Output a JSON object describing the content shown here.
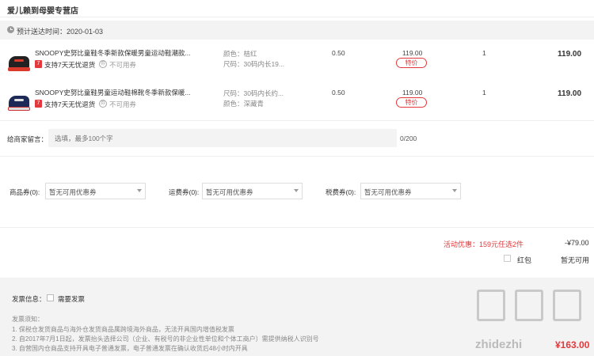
{
  "store": {
    "name": "爱儿赖到母婴专营店"
  },
  "delivery": {
    "label": "预计送达时间：2020-01-03"
  },
  "items": [
    {
      "title": "SNOOPY史努比童鞋冬季新款保暖男童运动鞋潮款...",
      "tag_seven": "7",
      "return_policy": "支持7天无忧退货",
      "no_coupon": "不可用券",
      "attr_line1": "颜色：桔红",
      "attr_line2": "尺码：30码内长19...",
      "weight": "0.50",
      "price": "119.00",
      "price_tag": "特价",
      "qty": "1",
      "subtotal": "119.00",
      "shoe_color": "#222222",
      "accent_color": "#d93a2b"
    },
    {
      "title": "SNOOPY史努比童鞋男童运动鞋棉靴冬季新款保暖...",
      "tag_seven": "7",
      "return_policy": "支持7天无忧退货",
      "no_coupon": "不可用券",
      "attr_line1": "尺码：30码内长约...",
      "attr_line2": "颜色：深藏青",
      "weight": "0.50",
      "price": "119.00",
      "price_tag": "特价",
      "qty": "1",
      "subtotal": "119.00",
      "shoe_color": "#1d2a57",
      "accent_color": "#e0e0e0"
    }
  ],
  "message": {
    "label": "给商家留言：",
    "placeholder": "选填，最多100个字",
    "count": "0/200"
  },
  "coupons": [
    {
      "label": "商品券(0):",
      "placeholder": "暂无可用优惠券"
    },
    {
      "label": "运费券(0):",
      "placeholder": "暂无可用优惠券"
    },
    {
      "label": "税费券(0):",
      "placeholder": "暂无可用优惠券"
    }
  ],
  "promotion": {
    "label": "活动优惠：159元任选2件",
    "amount": "-¥79.00"
  },
  "redpack": {
    "label": "红包",
    "status": "暂无可用"
  },
  "invoice": {
    "label": "发票信息：",
    "need": "需要发票",
    "notice_title": "发票须知：",
    "notices": [
      "1. 保税仓发货商品与海外仓发货商品属跨境海外商品，无法开具国内增值税发票",
      "2. 自2017年7月1日起，发票抬头选择公司（企业、有税号的非企业性单位和个体工商户）需提供纳税人识别号",
      "3. 自营国内仓商品支持开具电子普通发票，电子普通发票在确认收货后48小时内开具"
    ]
  },
  "watermark": {
    "text": "zhidezhi",
    "red": "¥163.00"
  }
}
